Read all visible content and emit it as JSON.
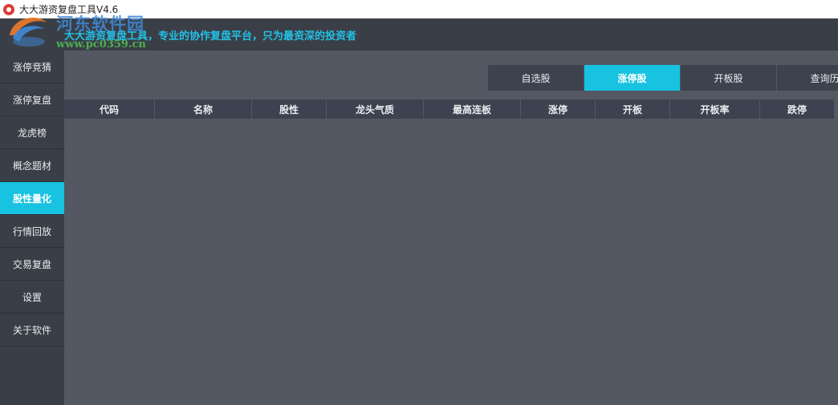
{
  "window": {
    "title": "大大游资复盘工具V4.6"
  },
  "header": {
    "slogan": "大大游资复盘工具，专业的协作复盘平台，只为最资深的投资者"
  },
  "watermark": {
    "text": "河东软件园",
    "url": "www.pc0359.cn"
  },
  "sidebar": {
    "items": [
      {
        "label": "涨停竞猜"
      },
      {
        "label": "涨停复盘"
      },
      {
        "label": "龙虎榜"
      },
      {
        "label": "概念题材"
      },
      {
        "label": "股性量化"
      },
      {
        "label": "行情回放"
      },
      {
        "label": "交易复盘"
      },
      {
        "label": "设置"
      },
      {
        "label": "关于软件"
      }
    ],
    "active": "股性量化"
  },
  "tabs": [
    {
      "label": "自选股"
    },
    {
      "label": "涨停股"
    },
    {
      "label": "开板股"
    },
    {
      "label": "查询历"
    }
  ],
  "active_tab": "涨停股",
  "table": {
    "columns": [
      "代码",
      "名称",
      "股性",
      "龙头气质",
      "最高连板",
      "涨停",
      "开板",
      "开板率",
      "跌停"
    ]
  },
  "colors": {
    "accent": "#17c3e0",
    "sidebar_bg": "#3a3f47",
    "main_bg": "#535862"
  }
}
